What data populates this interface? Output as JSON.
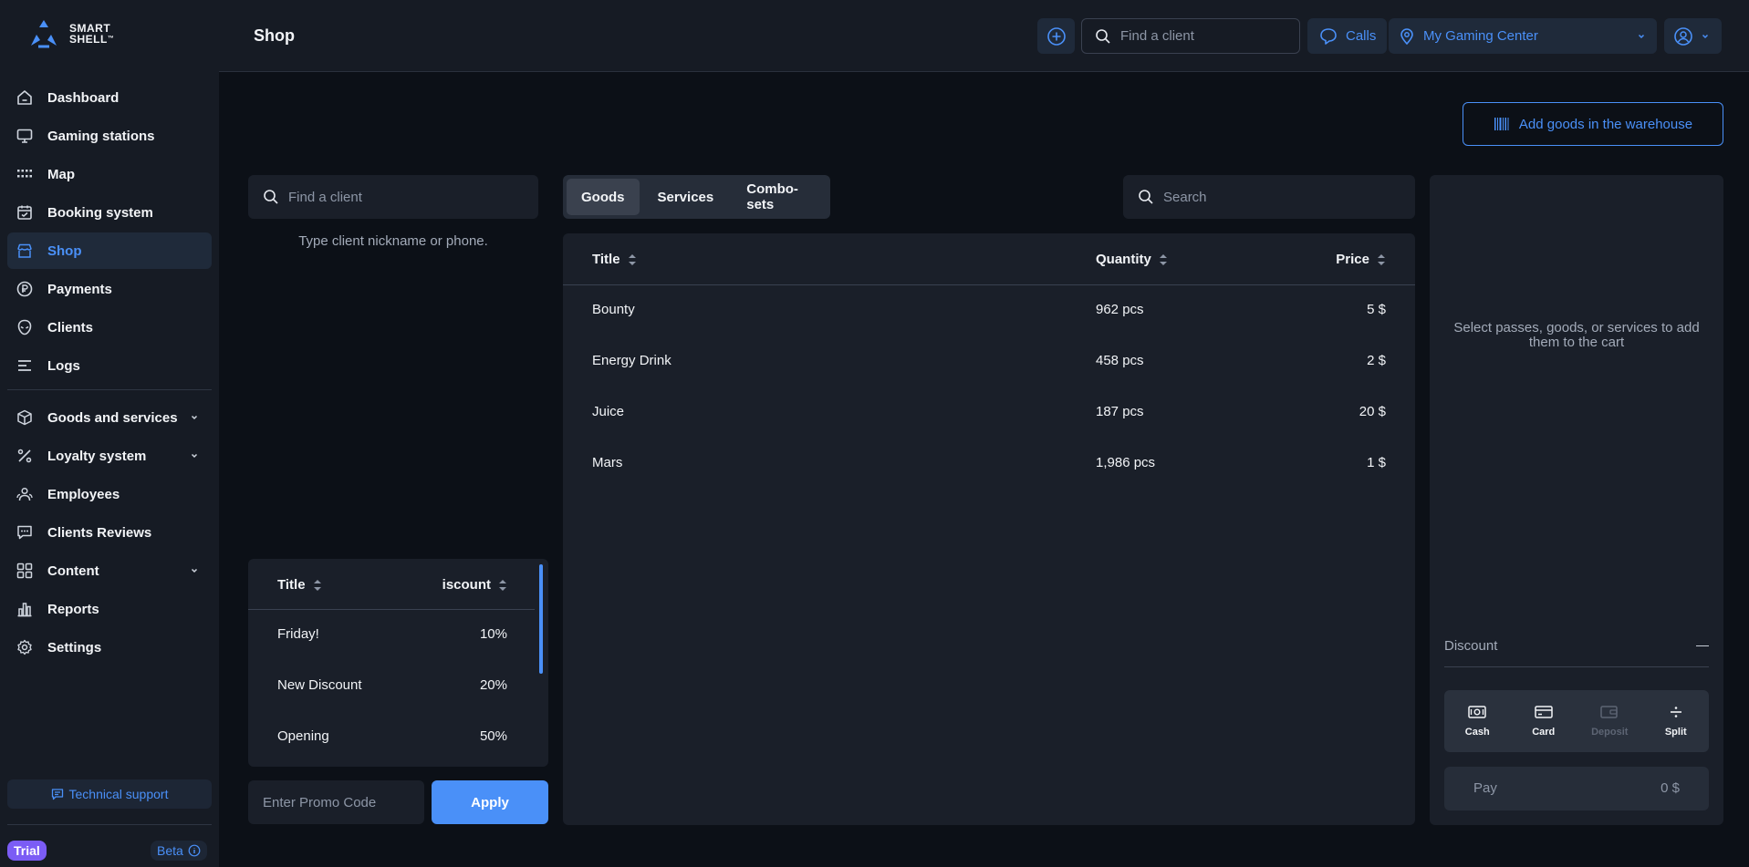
{
  "brand": {
    "line1": "SMART",
    "line2": "SHELL",
    "tm": "™"
  },
  "sidebar": {
    "items": [
      {
        "label": "Dashboard",
        "icon": "home-icon"
      },
      {
        "label": "Gaming stations",
        "icon": "monitor-icon"
      },
      {
        "label": "Map",
        "icon": "grid-dots-icon"
      },
      {
        "label": "Booking system",
        "icon": "calendar-icon"
      },
      {
        "label": "Shop",
        "icon": "store-icon",
        "active": true
      },
      {
        "label": "Payments",
        "icon": "currency-icon"
      },
      {
        "label": "Clients",
        "icon": "alien-icon"
      },
      {
        "label": "Logs",
        "icon": "lines-icon"
      }
    ],
    "items2": [
      {
        "label": "Goods and services",
        "icon": "box-icon",
        "expandable": true
      },
      {
        "label": "Loyalty system",
        "icon": "percent-icon",
        "expandable": true
      },
      {
        "label": "Employees",
        "icon": "users-icon"
      },
      {
        "label": "Clients Reviews",
        "icon": "message-icon"
      },
      {
        "label": "Content",
        "icon": "apps-icon",
        "expandable": true
      },
      {
        "label": "Reports",
        "icon": "bar-chart-icon"
      },
      {
        "label": "Settings",
        "icon": "gear-icon"
      }
    ],
    "support_label": "Technical support",
    "trial_label": "Trial",
    "beta_label": "Beta"
  },
  "header": {
    "title": "Shop",
    "search_placeholder": "Find a client",
    "calls_label": "Calls",
    "location": "My Gaming Center"
  },
  "toolbar": {
    "add_goods_label": "Add goods in the warehouse"
  },
  "client_search": {
    "placeholder": "Find a client",
    "hint": "Type client nickname or phone."
  },
  "tabs": [
    "Goods",
    "Services",
    "Combo-sets"
  ],
  "goods_search_placeholder": "Search",
  "goods_table": {
    "headers": {
      "title": "Title",
      "quantity": "Quantity",
      "price": "Price"
    },
    "rows": [
      {
        "title": "Bounty",
        "quantity": "962 pcs",
        "price": "5 $"
      },
      {
        "title": "Energy Drink",
        "quantity": "458 pcs",
        "price": "2 $"
      },
      {
        "title": "Juice",
        "quantity": "187 pcs",
        "price": "20 $"
      },
      {
        "title": "Mars",
        "quantity": "1,986 pcs",
        "price": "1 $"
      }
    ]
  },
  "discount_table": {
    "headers": {
      "title": "Title",
      "discount": "iscount"
    },
    "rows": [
      {
        "title": "Friday!",
        "discount": "10%"
      },
      {
        "title": "New Discount",
        "discount": "20%"
      },
      {
        "title": "Opening",
        "discount": "50%"
      }
    ]
  },
  "promo": {
    "placeholder": "Enter Promo Code",
    "apply_label": "Apply"
  },
  "cart": {
    "empty_text": "Select passes, goods, or services to add them to the cart",
    "discount_label": "Discount",
    "payment_methods": [
      {
        "label": "Cash",
        "icon": "cash-icon"
      },
      {
        "label": "Card",
        "icon": "card-icon"
      },
      {
        "label": "Deposit",
        "icon": "wallet-icon",
        "disabled": true
      },
      {
        "label": "Split",
        "icon": "divide-icon"
      }
    ],
    "pay_label": "Pay",
    "pay_value": "0 $"
  },
  "colors": {
    "accent": "#4a90f8",
    "trial": "#7b5cf5",
    "bg": "#0c1017",
    "panel": "#1a1f29"
  }
}
